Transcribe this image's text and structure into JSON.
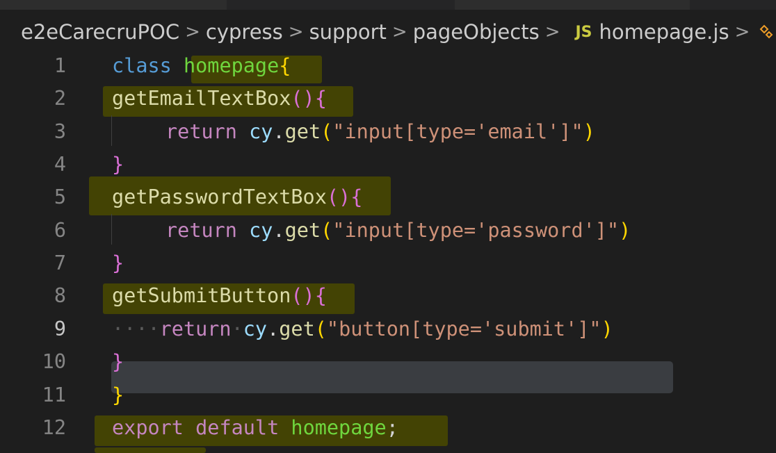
{
  "breadcrumb": {
    "items": [
      "e2eCarecruPOC",
      "cypress",
      "support",
      "pageObjects"
    ],
    "file_badge": "JS",
    "file_name": "homepage.js",
    "separator": ">"
  },
  "editor": {
    "active_line": 9,
    "lines": [
      {
        "num": "1",
        "tokens": [
          "class",
          " ",
          "homepage",
          "{"
        ]
      },
      {
        "num": "2",
        "tokens": [
          "getEmailTextBox",
          "()",
          "{"
        ]
      },
      {
        "num": "3",
        "tokens": [
          "return",
          " ",
          "cy",
          ".",
          "get",
          "(",
          "\"input[type='email']\"",
          ")"
        ]
      },
      {
        "num": "4",
        "tokens": [
          "}"
        ]
      },
      {
        "num": "5",
        "tokens": [
          "getPasswordTextBox",
          "()",
          "{"
        ]
      },
      {
        "num": "6",
        "tokens": [
          "return",
          " ",
          "cy",
          ".",
          "get",
          "(",
          "\"input[type='password']\"",
          ")"
        ]
      },
      {
        "num": "7",
        "tokens": [
          "}"
        ]
      },
      {
        "num": "8",
        "tokens": [
          "getSubmitButton",
          "()",
          "{"
        ]
      },
      {
        "num": "9",
        "tokens": [
          "····",
          "return",
          "·",
          "cy",
          ".",
          "get",
          "(",
          "\"button[type='submit']\"",
          ")"
        ]
      },
      {
        "num": "10",
        "tokens": [
          "}"
        ]
      },
      {
        "num": "11",
        "tokens": [
          "}"
        ]
      },
      {
        "num": "12",
        "tokens": [
          "export",
          " ",
          "default",
          " ",
          "homepage",
          ";"
        ]
      }
    ]
  },
  "colors": {
    "background": "#1e1e1e",
    "keyword": "#569cd6",
    "class_name": "#6fd63e",
    "function": "#dcdcaa",
    "control": "#c586c0",
    "variable": "#9cdcfe",
    "string": "#ce9178",
    "bracket": "#ffd700",
    "highlight": "#4a4a00"
  }
}
